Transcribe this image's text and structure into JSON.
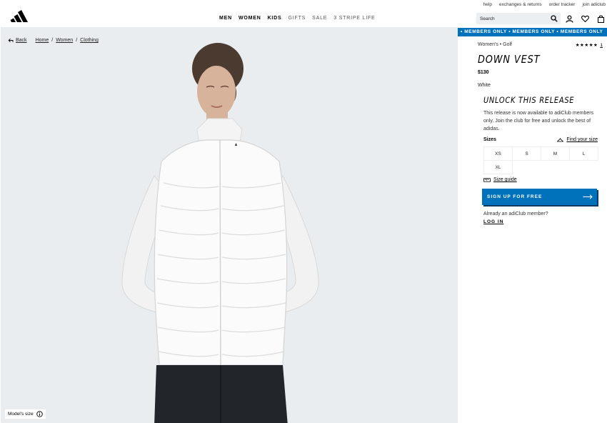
{
  "header": {
    "util_links": [
      "help",
      "exchanges & returns",
      "order tracker",
      "join adiclub"
    ],
    "nav": [
      {
        "label": "MEN",
        "strong": true
      },
      {
        "label": "WOMEN",
        "strong": true
      },
      {
        "label": "KIDS",
        "strong": true
      },
      {
        "label": "GIFTS",
        "strong": false
      },
      {
        "label": "SALE",
        "strong": false
      },
      {
        "label": "3 STRIPE LIFE",
        "strong": false
      }
    ],
    "search": {
      "placeholder": "Search"
    }
  },
  "breadcrumb": {
    "back": "Back",
    "items": [
      "Home",
      "Women",
      "Clothing"
    ],
    "separator": "/"
  },
  "image": {
    "models_size_label": "Model's size",
    "background_color": "#eaedef"
  },
  "product": {
    "members_banner": "• MEMBERS ONLY • MEMBERS ONLY • MEMBERS ONLY",
    "category": "Women's • Golf",
    "rating_stars": "★★★★★",
    "rating_count": "1",
    "name": "DOWN VEST",
    "price": "$130",
    "color": "White",
    "unlock_title": "UNLOCK THIS RELEASE",
    "unlock_description": "This release is now available to adiClub members only. Join the club for free and unlock the best of adidas.",
    "sizes_label": "Sizes",
    "find_your_size": "Find your size",
    "sizes": [
      "XS",
      "S",
      "M",
      "L",
      "XL"
    ],
    "size_guide": "Size guide",
    "cta_label": "SIGN UP FOR FREE",
    "already_member": "Already an adiClub member?",
    "login_label": "LOG IN",
    "accent_color": "#0071bb"
  }
}
